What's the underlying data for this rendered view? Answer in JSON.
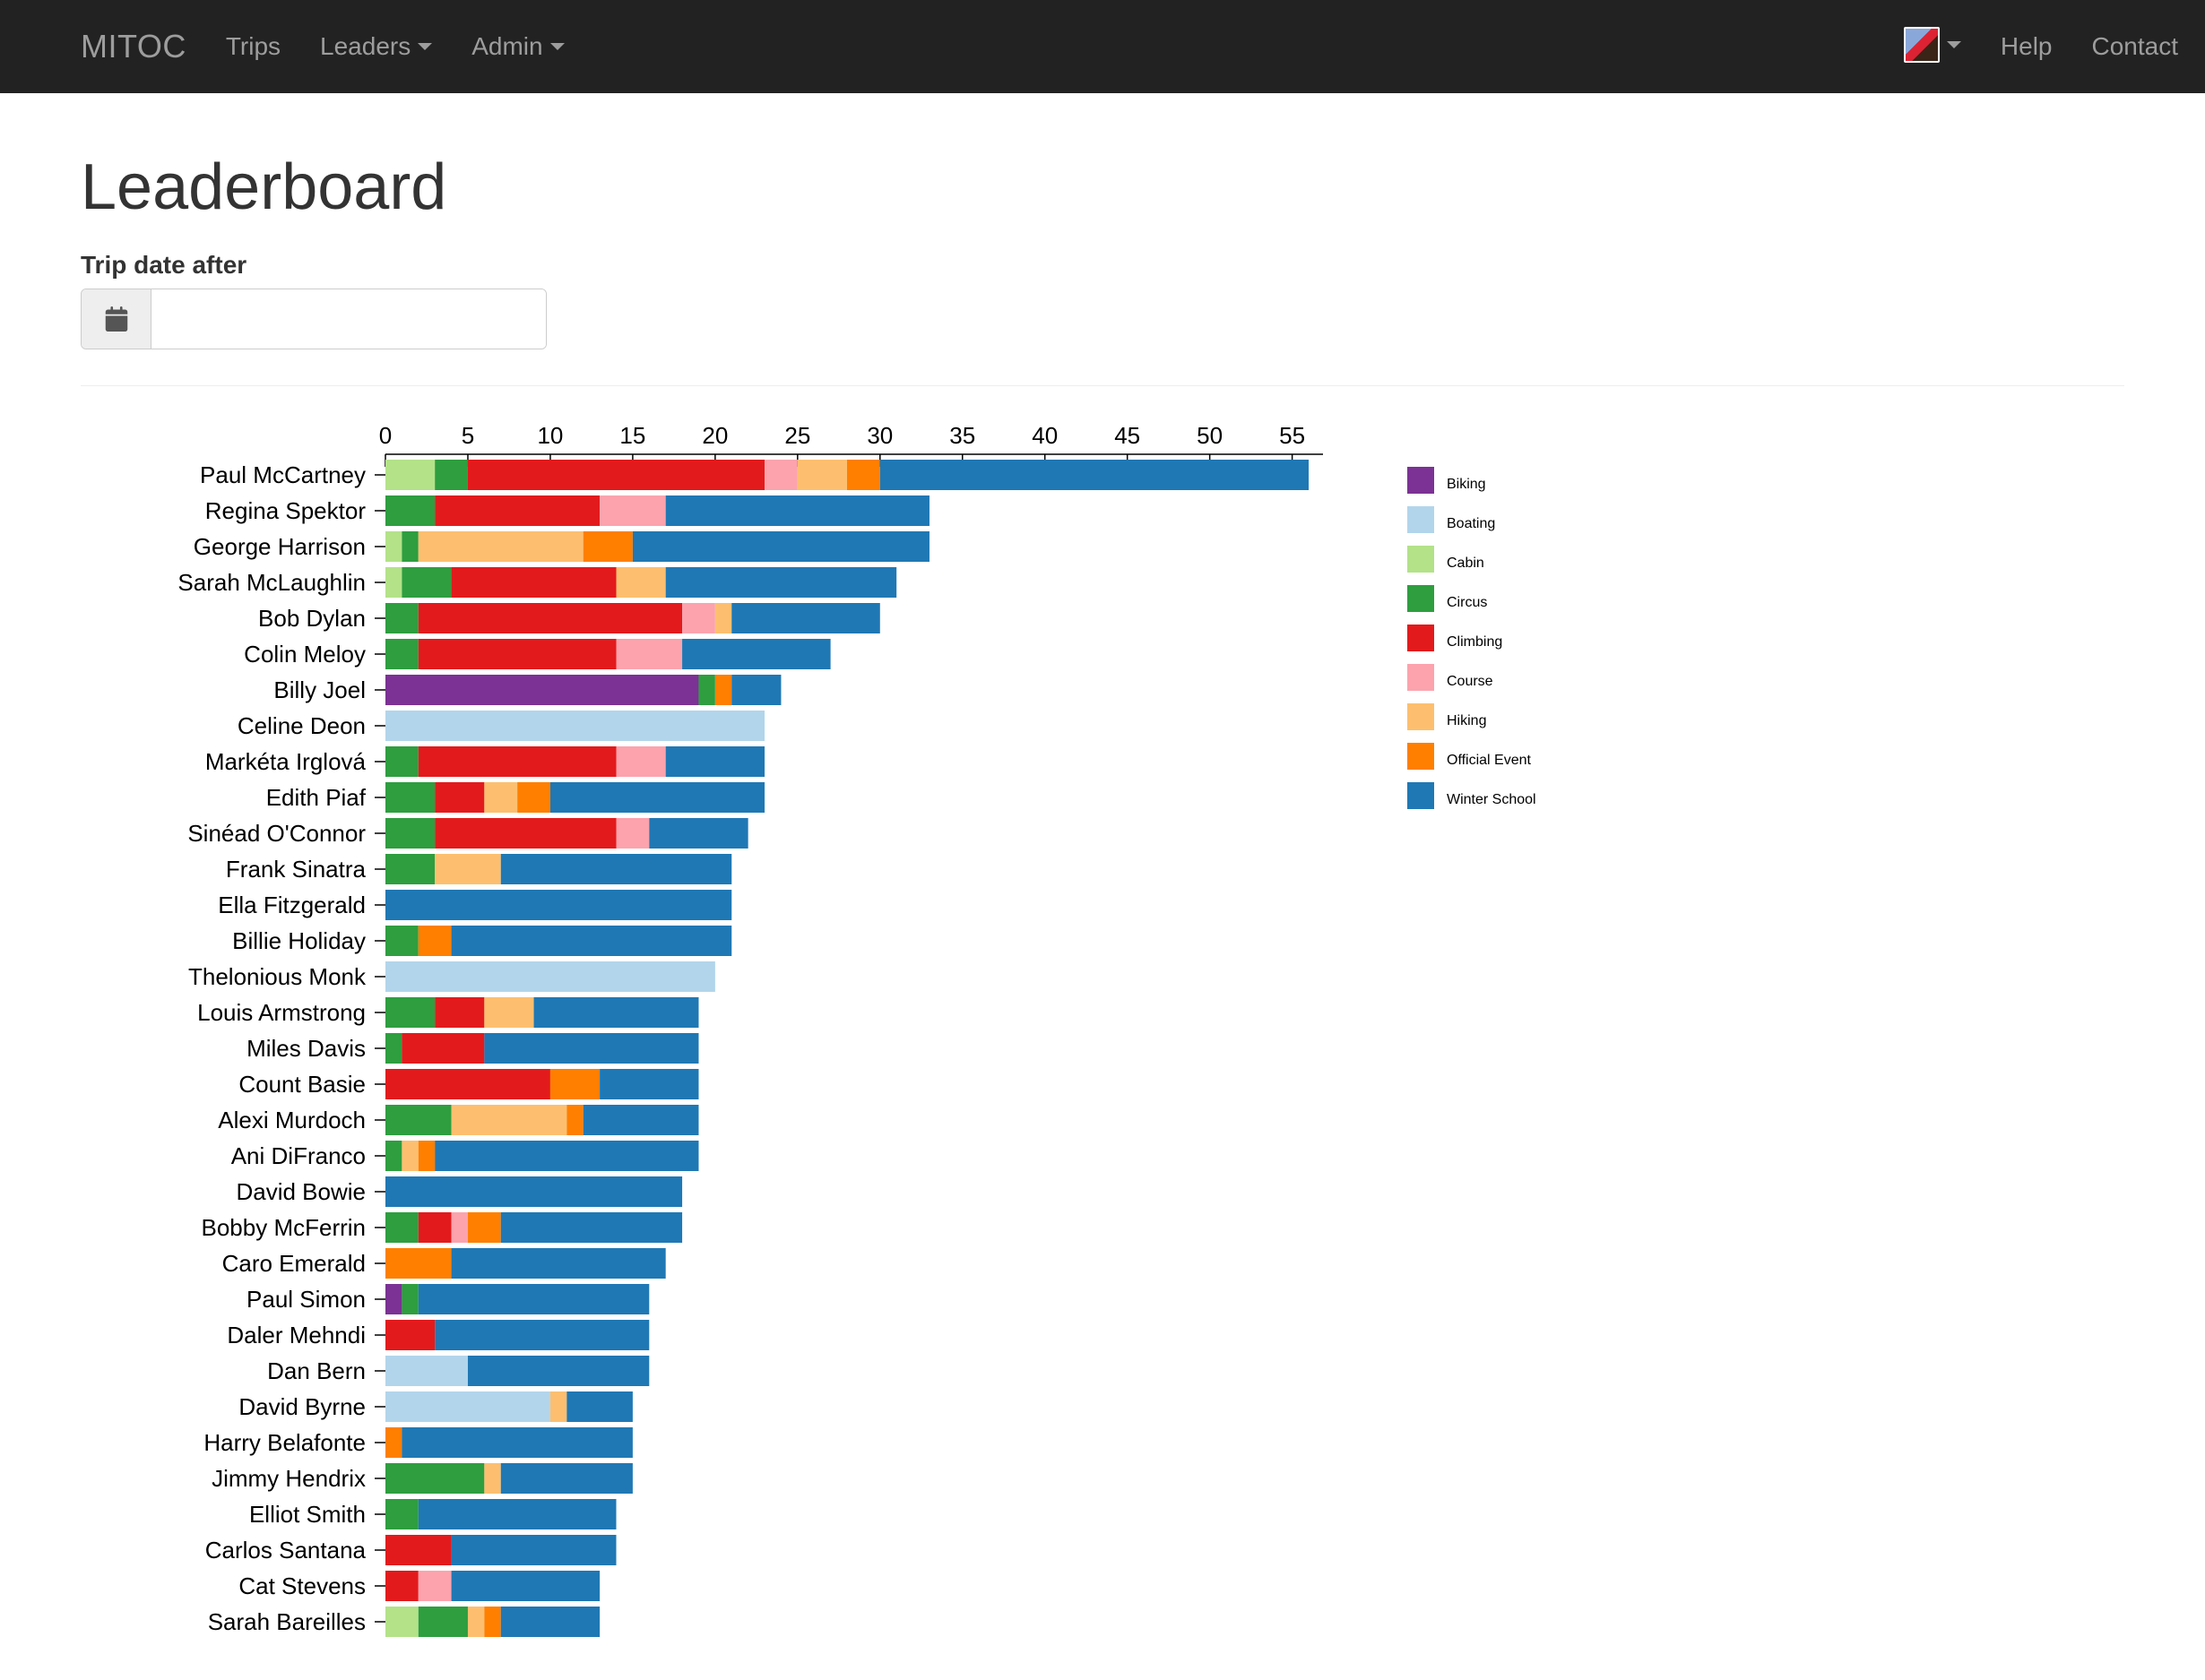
{
  "nav": {
    "brand": "MITOC",
    "left": [
      "Trips",
      "Leaders",
      "Admin"
    ],
    "right": [
      "Help",
      "Contact"
    ]
  },
  "page": {
    "title": "Leaderboard",
    "filter_label": "Trip date after",
    "date_value": ""
  },
  "colors": {
    "Biking": "#7B3294",
    "Boating": "#B2D5EB",
    "Cabin": "#B3E289",
    "Circus": "#2E9E3F",
    "Climbing": "#E31A1C",
    "Course": "#FCA3AD",
    "Hiking": "#FDBF6F",
    "Official Event": "#FF7F00",
    "Winter School": "#1F78B4"
  },
  "legend_order": [
    "Biking",
    "Boating",
    "Cabin",
    "Circus",
    "Climbing",
    "Course",
    "Hiking",
    "Official Event",
    "Winter School"
  ],
  "chart_data": {
    "type": "bar",
    "orientation": "horizontal",
    "stacked": true,
    "xlabel": "",
    "ylabel": "",
    "xlim": [
      0,
      56
    ],
    "xticks": [
      0,
      5,
      10,
      15,
      20,
      25,
      30,
      35,
      40,
      45,
      50,
      55
    ],
    "series_keys": [
      "Biking",
      "Boating",
      "Cabin",
      "Circus",
      "Climbing",
      "Course",
      "Hiking",
      "Official Event",
      "Winter School"
    ],
    "rows": [
      {
        "name": "Paul McCartney",
        "values": {
          "Cabin": 3,
          "Circus": 2,
          "Climbing": 18,
          "Course": 2,
          "Hiking": 3,
          "Official Event": 2,
          "Winter School": 26
        }
      },
      {
        "name": "Regina Spektor",
        "values": {
          "Circus": 3,
          "Climbing": 10,
          "Course": 4,
          "Winter School": 16
        }
      },
      {
        "name": "George Harrison",
        "values": {
          "Cabin": 1,
          "Circus": 1,
          "Hiking": 10,
          "Official Event": 3,
          "Winter School": 18
        }
      },
      {
        "name": "Sarah McLaughlin",
        "values": {
          "Cabin": 1,
          "Circus": 3,
          "Climbing": 10,
          "Hiking": 3,
          "Winter School": 14
        }
      },
      {
        "name": "Bob Dylan",
        "values": {
          "Circus": 2,
          "Climbing": 16,
          "Course": 2,
          "Hiking": 1,
          "Winter School": 9
        }
      },
      {
        "name": "Colin Meloy",
        "values": {
          "Circus": 2,
          "Climbing": 12,
          "Course": 4,
          "Winter School": 9
        }
      },
      {
        "name": "Billy Joel",
        "values": {
          "Biking": 19,
          "Circus": 1,
          "Official Event": 1,
          "Winter School": 3
        }
      },
      {
        "name": "Celine Deon",
        "values": {
          "Boating": 23
        }
      },
      {
        "name": "Markéta Irglová",
        "values": {
          "Circus": 2,
          "Climbing": 12,
          "Course": 3,
          "Winter School": 6
        }
      },
      {
        "name": "Edith Piaf",
        "values": {
          "Circus": 3,
          "Climbing": 3,
          "Hiking": 2,
          "Official Event": 2,
          "Winter School": 13
        }
      },
      {
        "name": "Sinéad O'Connor",
        "values": {
          "Circus": 3,
          "Climbing": 11,
          "Course": 2,
          "Winter School": 6
        }
      },
      {
        "name": "Frank Sinatra",
        "values": {
          "Circus": 3,
          "Hiking": 4,
          "Winter School": 14
        }
      },
      {
        "name": "Ella Fitzgerald",
        "values": {
          "Winter School": 21
        }
      },
      {
        "name": "Billie Holiday",
        "values": {
          "Circus": 2,
          "Official Event": 2,
          "Winter School": 17
        }
      },
      {
        "name": "Thelonious Monk",
        "values": {
          "Boating": 20
        }
      },
      {
        "name": "Louis Armstrong",
        "values": {
          "Circus": 3,
          "Climbing": 3,
          "Hiking": 3,
          "Winter School": 10
        }
      },
      {
        "name": "Miles Davis",
        "values": {
          "Circus": 1,
          "Climbing": 5,
          "Winter School": 13
        }
      },
      {
        "name": "Count Basie",
        "values": {
          "Climbing": 10,
          "Official Event": 3,
          "Winter School": 6
        }
      },
      {
        "name": "Alexi Murdoch",
        "values": {
          "Circus": 4,
          "Hiking": 7,
          "Official Event": 1,
          "Winter School": 7
        }
      },
      {
        "name": "Ani DiFranco",
        "values": {
          "Circus": 1,
          "Hiking": 1,
          "Official Event": 1,
          "Winter School": 16
        }
      },
      {
        "name": "David Bowie",
        "values": {
          "Winter School": 18
        }
      },
      {
        "name": "Bobby McFerrin",
        "values": {
          "Circus": 2,
          "Climbing": 2,
          "Course": 1,
          "Official Event": 2,
          "Winter School": 11
        }
      },
      {
        "name": "Caro Emerald",
        "values": {
          "Official Event": 4,
          "Winter School": 13
        }
      },
      {
        "name": "Paul Simon",
        "values": {
          "Biking": 1,
          "Circus": 1,
          "Winter School": 14
        }
      },
      {
        "name": "Daler Mehndi",
        "values": {
          "Climbing": 3,
          "Winter School": 13
        }
      },
      {
        "name": "Dan Bern",
        "values": {
          "Boating": 5,
          "Winter School": 11
        }
      },
      {
        "name": "David Byrne",
        "values": {
          "Boating": 10,
          "Hiking": 1,
          "Winter School": 4
        }
      },
      {
        "name": "Harry Belafonte",
        "values": {
          "Official Event": 1,
          "Winter School": 14
        }
      },
      {
        "name": "Jimmy Hendrix",
        "values": {
          "Circus": 6,
          "Hiking": 1,
          "Winter School": 8
        }
      },
      {
        "name": "Elliot Smith",
        "values": {
          "Circus": 2,
          "Winter School": 12
        }
      },
      {
        "name": "Carlos Santana",
        "values": {
          "Climbing": 4,
          "Winter School": 10
        }
      },
      {
        "name": "Cat Stevens",
        "values": {
          "Climbing": 2,
          "Course": 2,
          "Winter School": 9
        }
      },
      {
        "name": "Sarah Bareilles",
        "values": {
          "Cabin": 2,
          "Circus": 3,
          "Hiking": 1,
          "Official Event": 1,
          "Winter School": 6
        }
      }
    ]
  }
}
